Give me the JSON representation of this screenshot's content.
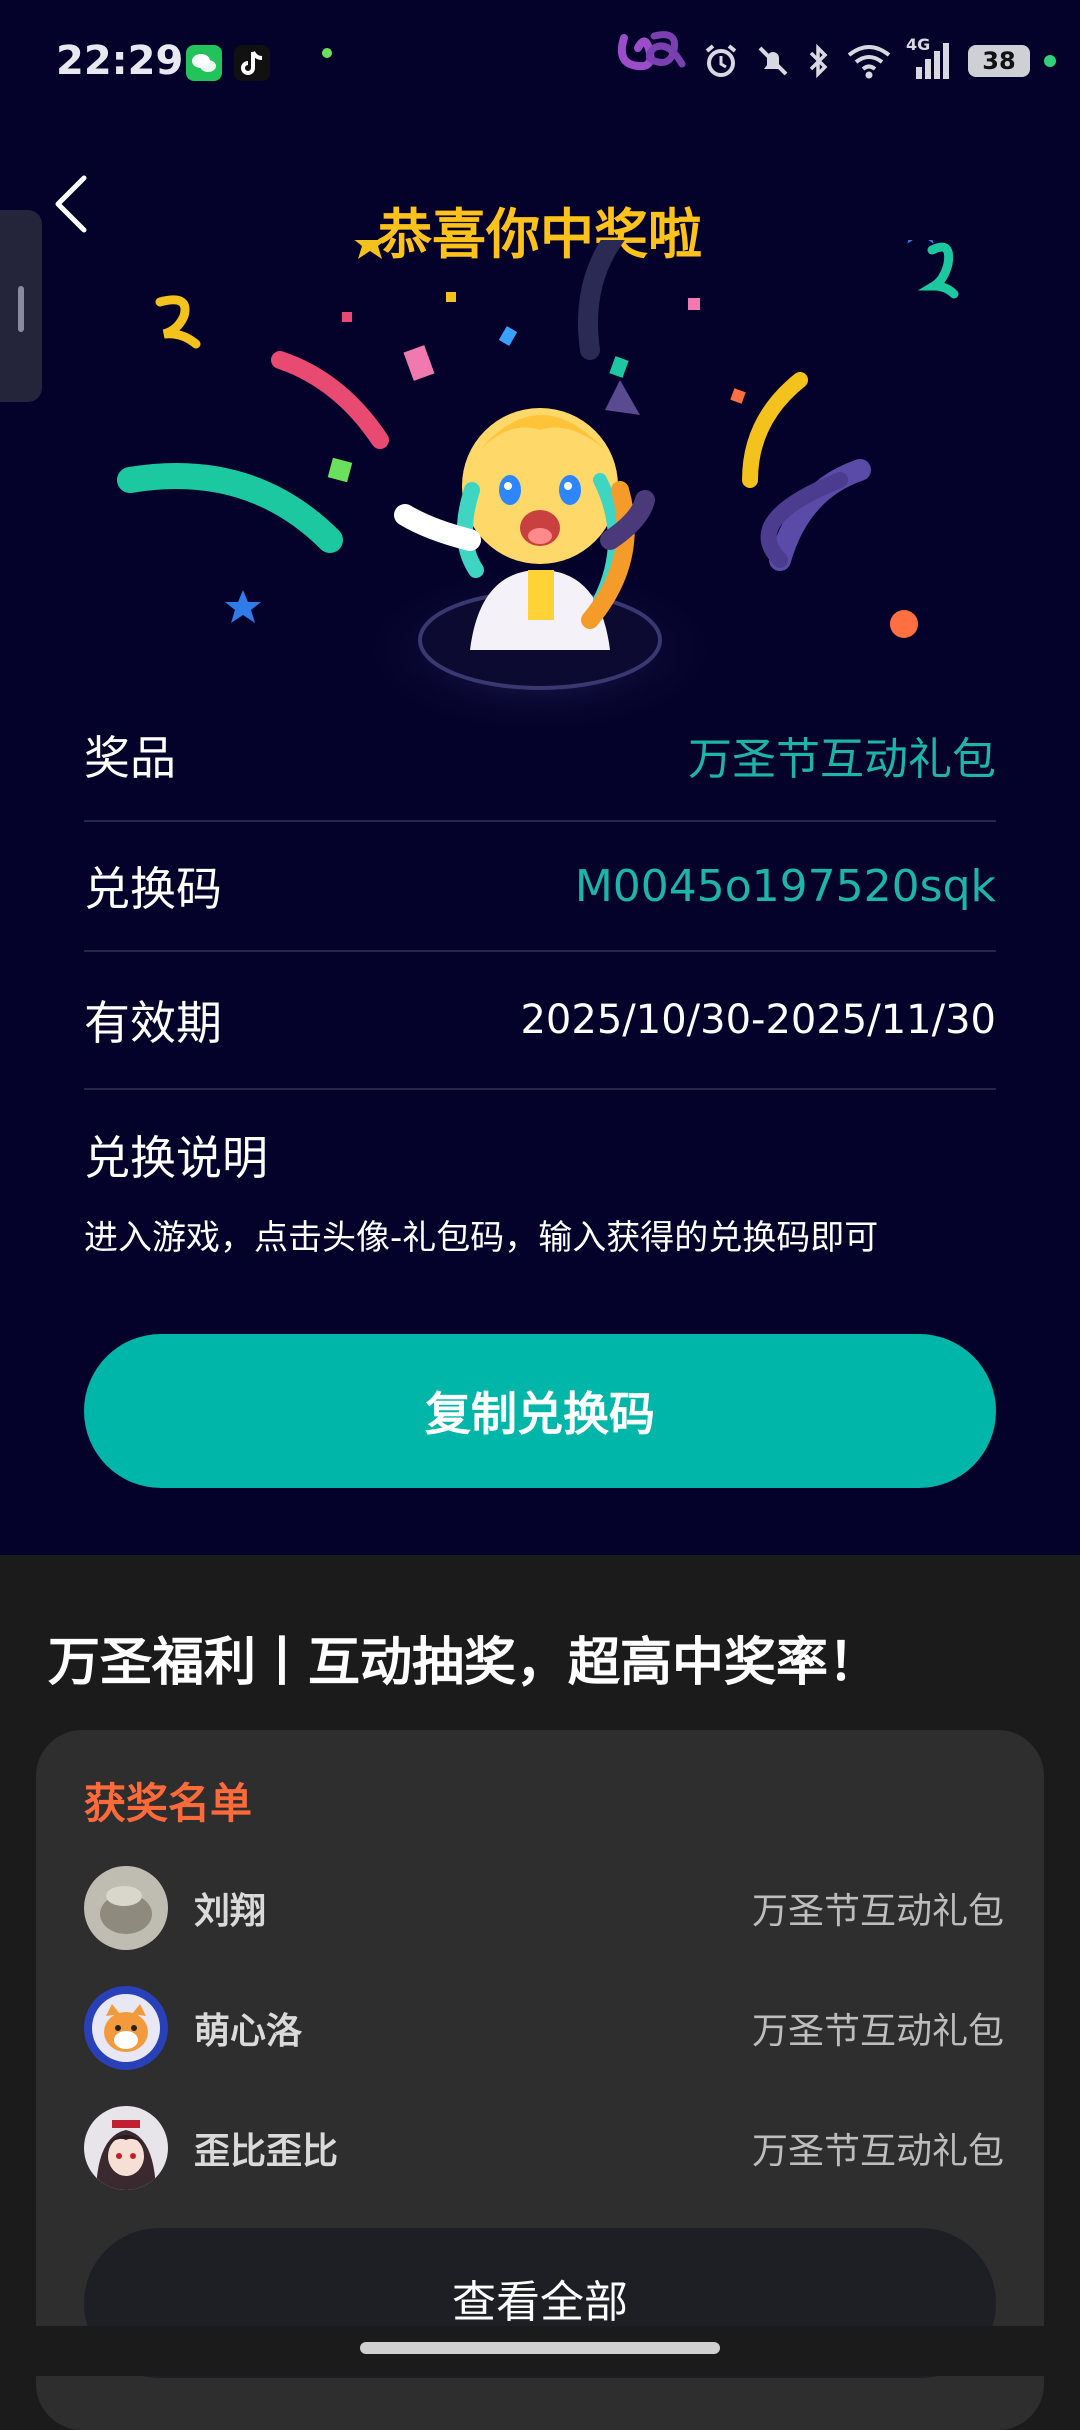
{
  "status_bar": {
    "time": "22:29",
    "network": "4G",
    "battery": "38",
    "icons": [
      "wechat-icon",
      "tiktok-icon",
      "alarm-icon",
      "mute-icon",
      "bluetooth-icon",
      "wifi-icon",
      "signal-icon",
      "battery-icon"
    ]
  },
  "header": {
    "title": "恭喜你中奖啦",
    "back_icon": "chevron-left-icon"
  },
  "prize_details": {
    "prize_label": "奖品",
    "prize_value": "万圣节互动礼包",
    "code_label": "兑换码",
    "code_value": "M0045o197520sqk",
    "validity_label": "有效期",
    "validity_value": "2025/10/30-2025/11/30",
    "instructions_label": "兑换说明",
    "instructions_text": "进入游戏，点击头像-礼包码，输入获得的兑换码即可"
  },
  "copy_button_label": "复制兑换码",
  "promo": {
    "title": "万圣福利丨互动抽奖，超高中奖率！"
  },
  "winners": {
    "title": "获奖名单",
    "list": [
      {
        "name": "刘翔",
        "prize": "万圣节互动礼包"
      },
      {
        "name": "萌心洛",
        "prize": "万圣节互动礼包"
      },
      {
        "name": "歪比歪比",
        "prize": "万圣节互动礼包"
      }
    ],
    "view_all_label": "查看全部"
  },
  "colors": {
    "top_background": "#04022a",
    "accent_teal": "#00b6a8",
    "title_yellow": "#ffc21a",
    "winners_orange": "#ff6a3a",
    "bottom_background": "#1b1b1b"
  }
}
